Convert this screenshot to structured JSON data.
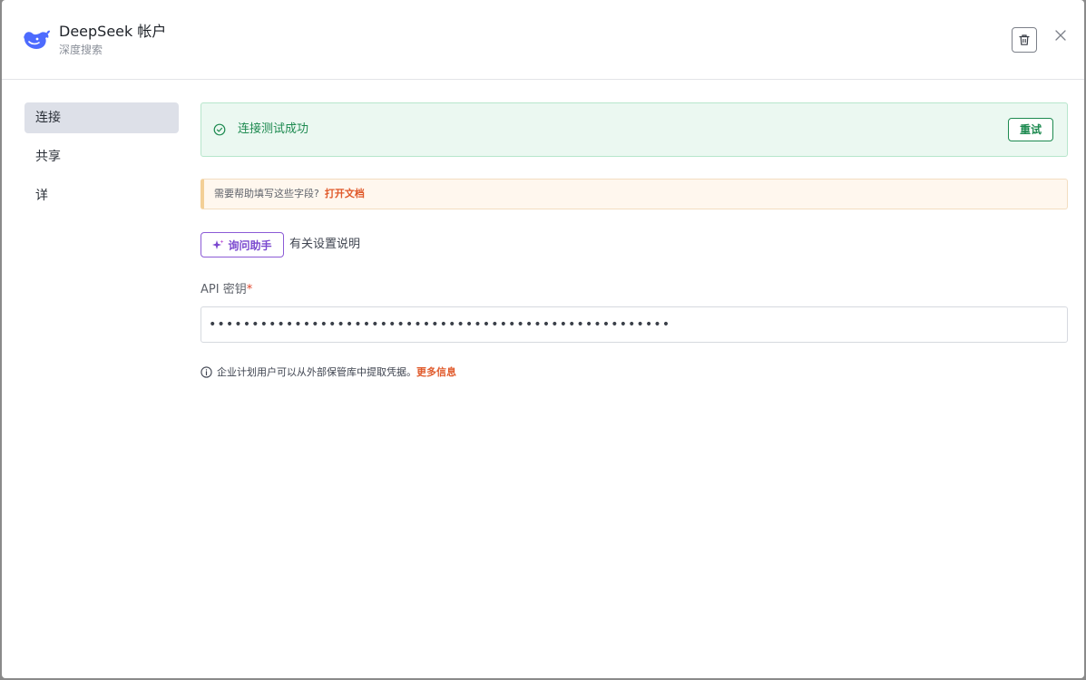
{
  "header": {
    "title": "DeepSeek 帐户",
    "subtitle": "深度搜索",
    "logo_icon": "deepseek-whale-logo",
    "delete_icon": "trash-icon",
    "close_icon": "close-icon"
  },
  "sidebar": {
    "items": [
      {
        "label": "连接",
        "active": true
      },
      {
        "label": "共享",
        "active": false
      },
      {
        "label": "详",
        "active": false
      }
    ]
  },
  "main": {
    "success": {
      "icon": "check-circle-icon",
      "message": "连接测试成功",
      "retry_label": "重试",
      "color": "#1d8a50"
    },
    "help": {
      "text": "需要帮助填写这些字段?",
      "link": "打开文档"
    },
    "assistant": {
      "icon": "sparkle-icon",
      "button_label": "询问助手",
      "description": "有关设置说明"
    },
    "api_key": {
      "label": "API 密钥",
      "required_mark": "*",
      "value": "••••••••••••••••••••••••••••••••••••••••••••••••••••••"
    },
    "info": {
      "icon": "info-icon",
      "text": "企业计划用户可以从外部保管库中提取凭据。",
      "link": "更多信息"
    }
  },
  "colors": {
    "accent_link": "#e05a2b",
    "assistant_purple": "#7a48cf",
    "logo_blue": "#4d6bfe"
  }
}
